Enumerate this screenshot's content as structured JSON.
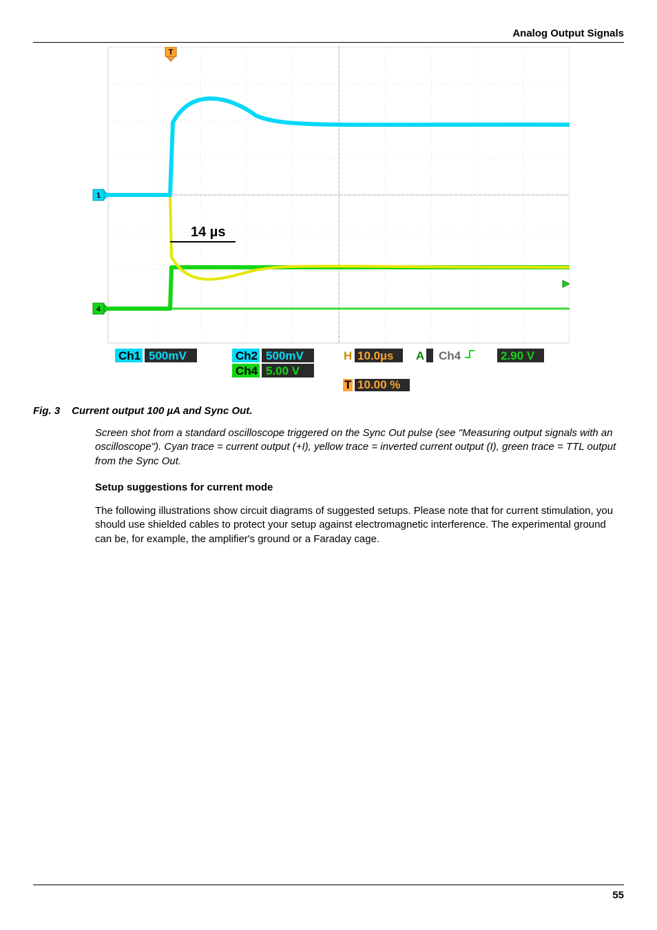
{
  "header": {
    "title": "Analog Output Signals"
  },
  "scope": {
    "annotation": "14 µs",
    "readout": {
      "ch1_label": "Ch1",
      "ch1_val": "500mV",
      "ch2_label": "Ch2",
      "ch2_val": "500mV",
      "ch4_label": "Ch4",
      "ch4_val": "5.00 V",
      "h_prefix": "H",
      "h_val": "10.0µs",
      "a_prefix": "A",
      "trig_ch": "Ch4",
      "trig_edge": "↓",
      "trig_level": "2.90 V",
      "t_prefix": "T",
      "t_val": "10.00 %"
    }
  },
  "figure": {
    "label": "Fig. 3",
    "title": "Current output 100 µA and Sync Out.",
    "description": "Screen shot from a standard oscilloscope triggered on the Sync Out pulse (see \"Measuring output signals with an oscilloscope\"). Cyan trace = current output (+I), yellow trace = inverted current output (I), green trace = TTL output from the Sync Out."
  },
  "section": {
    "heading": "Setup suggestions for current mode",
    "body": "The following illustrations show circuit diagrams of suggested setups. Please note that for current stimulation, you should use shielded cables to protect your setup against electromagnetic interference. The experimental ground can be, for example, the amplifier's ground or a Faraday cage."
  },
  "footer": {
    "page": "55"
  }
}
